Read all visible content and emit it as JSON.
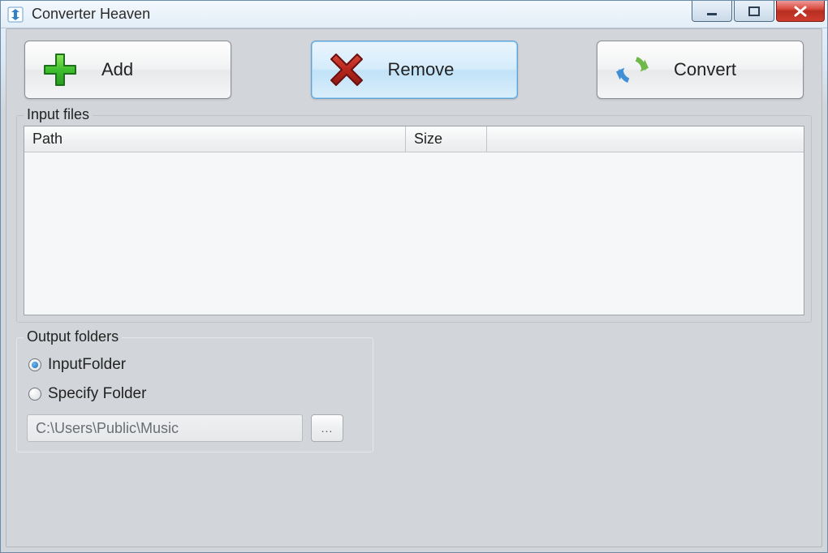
{
  "window": {
    "title": "Converter Heaven"
  },
  "toolbar": {
    "add_label": "Add",
    "remove_label": "Remove",
    "convert_label": "Convert"
  },
  "input_files": {
    "legend": "Input files",
    "columns": {
      "path": "Path",
      "size": "Size"
    },
    "rows": []
  },
  "output_folders": {
    "legend": "Output folders",
    "options": {
      "input_folder_label": "InputFolder",
      "specify_folder_label": "Specify Folder"
    },
    "selected": "input_folder",
    "specify_path": "C:\\Users\\Public\\Music",
    "browse_label": "..."
  }
}
